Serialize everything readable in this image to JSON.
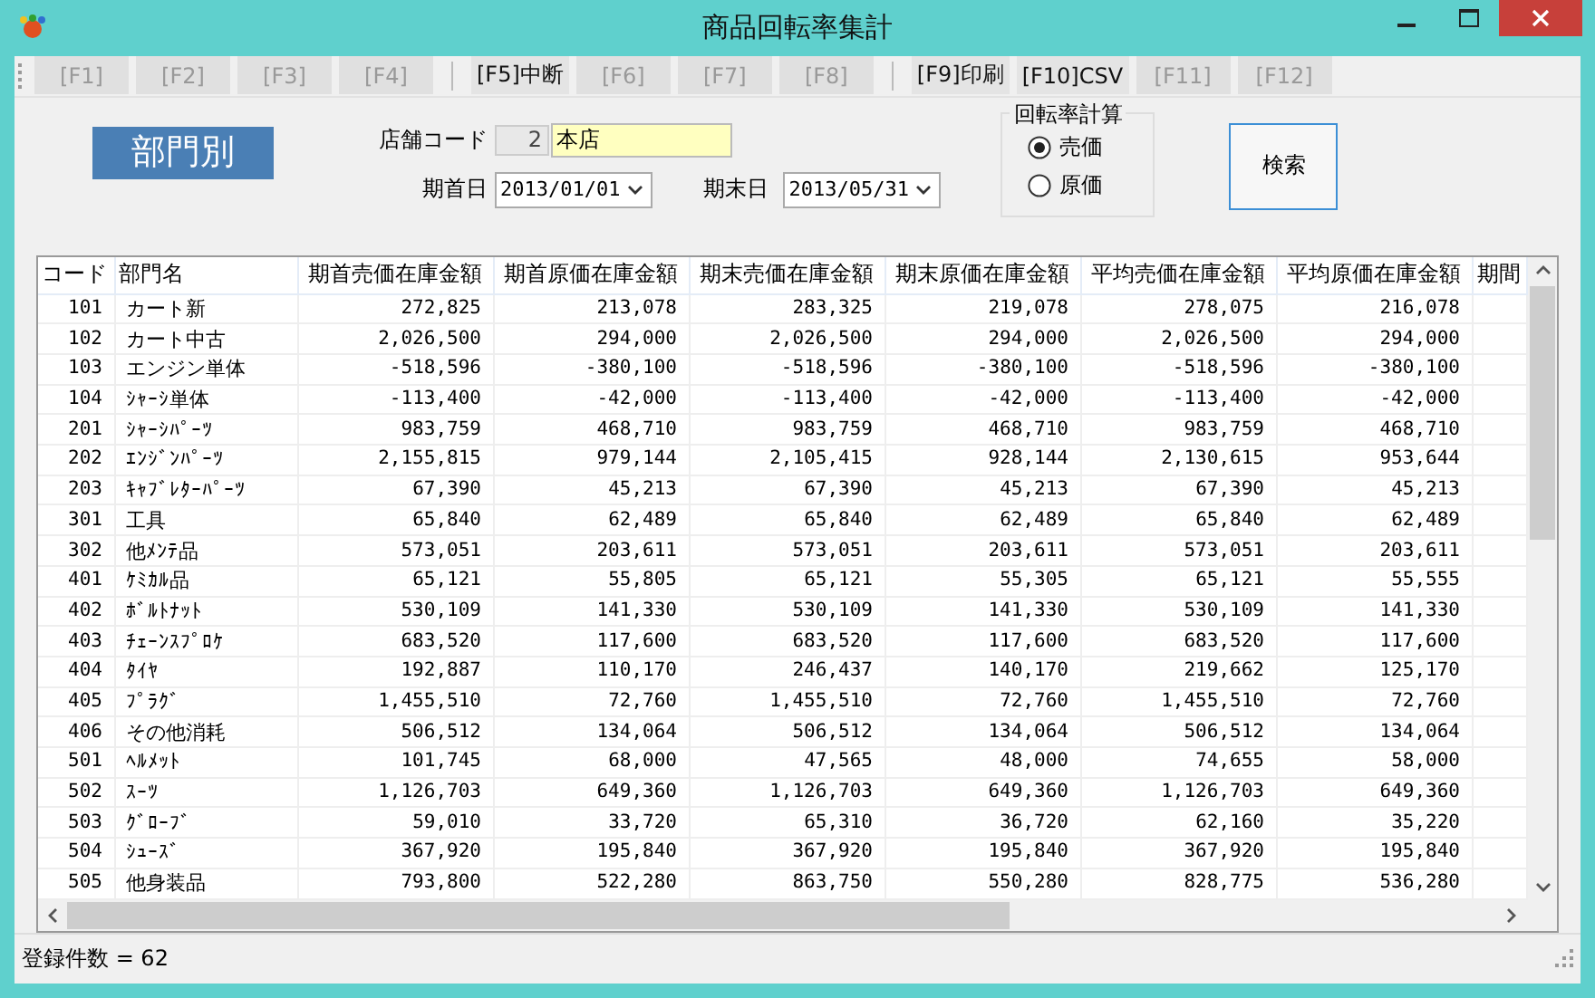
{
  "window": {
    "title": "商品回転率集計"
  },
  "function_keys": [
    {
      "label": "[F1]",
      "disabled": true
    },
    {
      "label": "[F2]",
      "disabled": true
    },
    {
      "label": "[F3]",
      "disabled": true
    },
    {
      "label": "[F4]",
      "disabled": true
    },
    {
      "label": "[F5]中断",
      "disabled": false
    },
    {
      "label": "[F6]",
      "disabled": true
    },
    {
      "label": "[F7]",
      "disabled": true
    },
    {
      "label": "[F8]",
      "disabled": true
    },
    {
      "label": "[F9]印刷",
      "disabled": false
    },
    {
      "label": "[F10]CSV",
      "disabled": false
    },
    {
      "label": "[F11]",
      "disabled": true
    },
    {
      "label": "[F12]",
      "disabled": true
    }
  ],
  "mode_label": "部門別",
  "store": {
    "label": "店舗コード",
    "code": "2",
    "name": "本店"
  },
  "start_date": {
    "label": "期首日",
    "value": "2013/01/01"
  },
  "end_date": {
    "label": "期末日",
    "value": "2013/05/31"
  },
  "rate_calc": {
    "title": "回転率計算",
    "options": [
      {
        "label": "売価",
        "selected": true
      },
      {
        "label": "原価",
        "selected": false
      }
    ]
  },
  "search_button": "検索",
  "table": {
    "columns": [
      "コード",
      "部門名",
      "期首売価在庫金額",
      "期首原価在庫金額",
      "期末売価在庫金額",
      "期末原価在庫金額",
      "平均売価在庫金額",
      "平均原価在庫金額",
      "期間"
    ],
    "rows": [
      [
        "101",
        "カート新",
        "272,825",
        "213,078",
        "283,325",
        "219,078",
        "278,075",
        "216,078"
      ],
      [
        "102",
        "カート中古",
        "2,026,500",
        "294,000",
        "2,026,500",
        "294,000",
        "2,026,500",
        "294,000"
      ],
      [
        "103",
        "エンジン単体",
        "-518,596",
        "-380,100",
        "-518,596",
        "-380,100",
        "-518,596",
        "-380,100"
      ],
      [
        "104",
        "ｼｬｰｼ単体",
        "-113,400",
        "-42,000",
        "-113,400",
        "-42,000",
        "-113,400",
        "-42,000"
      ],
      [
        "201",
        "ｼｬｰｼﾊﾟｰﾂ",
        "983,759",
        "468,710",
        "983,759",
        "468,710",
        "983,759",
        "468,710"
      ],
      [
        "202",
        "ｴﾝｼﾞﾝﾊﾟｰﾂ",
        "2,155,815",
        "979,144",
        "2,105,415",
        "928,144",
        "2,130,615",
        "953,644"
      ],
      [
        "203",
        "ｷｬﾌﾞﾚﾀｰﾊﾟｰﾂ",
        "67,390",
        "45,213",
        "67,390",
        "45,213",
        "67,390",
        "45,213"
      ],
      [
        "301",
        "工具",
        "65,840",
        "62,489",
        "65,840",
        "62,489",
        "65,840",
        "62,489"
      ],
      [
        "302",
        "他ﾒﾝﾃ品",
        "573,051",
        "203,611",
        "573,051",
        "203,611",
        "573,051",
        "203,611"
      ],
      [
        "401",
        "ｹﾐｶﾙ品",
        "65,121",
        "55,805",
        "65,121",
        "55,305",
        "65,121",
        "55,555"
      ],
      [
        "402",
        "ﾎﾞﾙﾄﾅｯﾄ",
        "530,109",
        "141,330",
        "530,109",
        "141,330",
        "530,109",
        "141,330"
      ],
      [
        "403",
        "ﾁｪｰﾝｽﾌﾟﾛｹ",
        "683,520",
        "117,600",
        "683,520",
        "117,600",
        "683,520",
        "117,600"
      ],
      [
        "404",
        "ﾀｲﾔ",
        "192,887",
        "110,170",
        "246,437",
        "140,170",
        "219,662",
        "125,170"
      ],
      [
        "405",
        "ﾌﾟﾗｸﾞ",
        "1,455,510",
        "72,760",
        "1,455,510",
        "72,760",
        "1,455,510",
        "72,760"
      ],
      [
        "406",
        "その他消耗",
        "506,512",
        "134,064",
        "506,512",
        "134,064",
        "506,512",
        "134,064"
      ],
      [
        "501",
        "ﾍﾙﾒｯﾄ",
        "101,745",
        "68,000",
        "47,565",
        "48,000",
        "74,655",
        "58,000"
      ],
      [
        "502",
        "ｽｰﾂ",
        "1,126,703",
        "649,360",
        "1,126,703",
        "649,360",
        "1,126,703",
        "649,360"
      ],
      [
        "503",
        "ｸﾞﾛｰﾌﾞ",
        "59,010",
        "33,720",
        "65,310",
        "36,720",
        "62,160",
        "35,220"
      ],
      [
        "504",
        "ｼｭｰｽﾞ",
        "367,920",
        "195,840",
        "367,920",
        "195,840",
        "367,920",
        "195,840"
      ],
      [
        "505",
        "他身装品",
        "793,800",
        "522,280",
        "863,750",
        "550,280",
        "828,775",
        "536,280"
      ]
    ]
  },
  "status_bar": "登録件数 = 62"
}
